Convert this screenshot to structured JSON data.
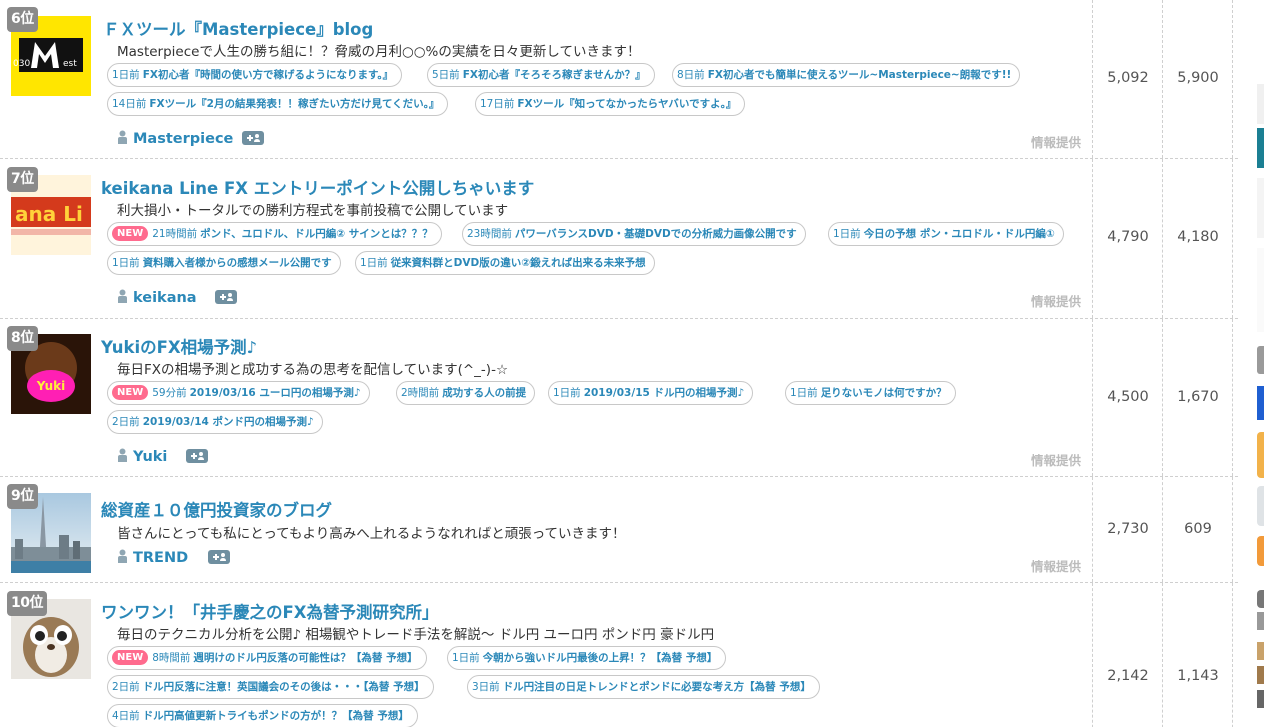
{
  "entries": [
    {
      "rank": "6位",
      "title": "ＦＸツール『Masterpiece』blog",
      "description": "Masterpieceで人生の勝ち組に！？脅威の月利○○%の実績を日々更新していきます！",
      "posts": [
        {
          "new": "",
          "ago": "1日前",
          "text": "FX初心者『時間の使い方で稼げるようになります。』"
        },
        {
          "new": "",
          "ago": "5日前",
          "text": "FX初心者『そろそろ稼ぎませんか？』"
        },
        {
          "new": "",
          "ago": "8日前",
          "text": "FX初心者でも簡単に使えるツール~Masterpiece~朗報です!!"
        },
        {
          "new": "",
          "ago": "14日前",
          "text": "FXツール『2月の結果発表！！稼ぎたい方だけ見てくだい。』"
        },
        {
          "new": "",
          "ago": "17日前",
          "text": "FXツール『知ってなかったらヤバいですよ。』"
        }
      ],
      "author": "Masterpiece",
      "info_label": "情報提供",
      "stat_in": "5,092",
      "stat_out": "5,900"
    },
    {
      "rank": "7位",
      "title": "keikana Line FX エントリーポイント公開しちゃいます",
      "description": "利大損小・トータルでの勝利方程式を事前投稿で公開しています",
      "posts": [
        {
          "new": "NEW",
          "ago": "21時間前",
          "text": "ポンド、ユロドル、ドル円編② サインとは？？？"
        },
        {
          "new": "",
          "ago": "23時間前",
          "text": "パワーバランスDVD・基礎DVDでの分析威力画像公開です"
        },
        {
          "new": "",
          "ago": "1日前",
          "text": "今日の予想 ポン・ユロドル・ドル円編①"
        },
        {
          "new": "",
          "ago": "1日前",
          "text": "資料購入者様からの感想メール公開です"
        },
        {
          "new": "",
          "ago": "1日前",
          "text": "従来資料群とDVD版の違い②鍛えれば出来る未来予想"
        }
      ],
      "author": "keikana",
      "info_label": "情報提供",
      "stat_in": "4,790",
      "stat_out": "4,180"
    },
    {
      "rank": "8位",
      "title": "YukiのFX相場予測♪",
      "description": "毎日FXの相場予測と成功する為の思考を配信しています(^_-)-☆",
      "posts": [
        {
          "new": "NEW",
          "ago": "59分前",
          "text": "2019/03/16 ユーロ円の相場予測♪"
        },
        {
          "new": "",
          "ago": "2時間前",
          "text": "成功する人の前提"
        },
        {
          "new": "",
          "ago": "1日前",
          "text": "2019/03/15 ドル円の相場予測♪"
        },
        {
          "new": "",
          "ago": "1日前",
          "text": "足りないモノは何ですか？"
        },
        {
          "new": "",
          "ago": "2日前",
          "text": "2019/03/14 ポンド円の相場予測♪"
        }
      ],
      "author": "Yuki",
      "thumb_text": "Yuki",
      "info_label": "情報提供",
      "stat_in": "4,500",
      "stat_out": "1,670"
    },
    {
      "rank": "9位",
      "title": "総資産１０億円投資家のブログ",
      "description": "皆さんにとっても私にとってもより高みへ上れるようなれればと頑張っていきます！",
      "posts": [],
      "author": "TREND",
      "info_label": "情報提供",
      "stat_in": "2,730",
      "stat_out": "609"
    },
    {
      "rank": "10位",
      "title": "ワンワン！「井手慶之のFX為替予測研究所」",
      "description": "毎日のテクニカル分析を公開♪ 相場観やトレード手法を解説～ ドル円 ユーロ円 ポンド円 豪ドル円",
      "posts": [
        {
          "new": "NEW",
          "ago": "8時間前",
          "text": "週明けのドル円反落の可能性は？【為替 予想】"
        },
        {
          "new": "",
          "ago": "1日前",
          "text": "今朝から強いドル円最後の上昇！？【為替 予想】"
        },
        {
          "new": "",
          "ago": "2日前",
          "text": "ドル円反落に注意！英国議会のその後は・・・【為替 予想】"
        },
        {
          "new": "",
          "ago": "3日前",
          "text": "ドル円注目の日足トレンドとポンドに必要な考え方【為替 予想】"
        },
        {
          "new": "",
          "ago": "4日前",
          "text": "ドル円高値更新トライもポンドの方が！？【為替 予想】"
        }
      ],
      "author": "",
      "info_label": "",
      "stat_in": "2,142",
      "stat_out": "1,143"
    }
  ],
  "colors": {
    "link": "#2b88b8",
    "rank_badge": "#8a8a8a",
    "new_badge": "#ff6b8e",
    "info_gray": "#bcbcbc",
    "author_button": "#6f8fa0"
  },
  "icons": [
    "person-icon",
    "add-user-icon"
  ]
}
